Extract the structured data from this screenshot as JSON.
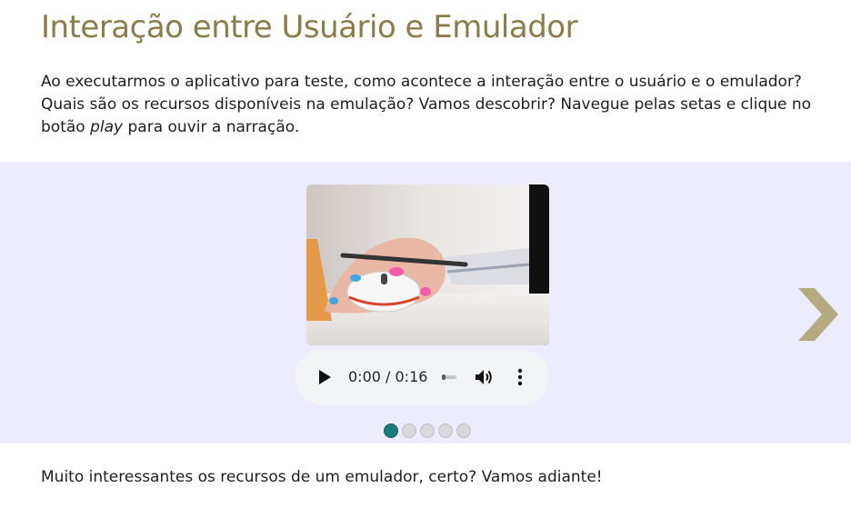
{
  "header": {
    "title": "Interação entre Usuário e Emulador"
  },
  "intro": {
    "text_before": "Ao executarmos o aplicativo para teste, como acontece a interação entre o usuário e o emulador? Quais são os recursos disponíveis na emulação? Vamos descobrir? Navegue pelas setas e clique no botão ",
    "text_italic": "play",
    "text_after": " para ouvir a narração."
  },
  "carousel": {
    "background_color": "#ececfd",
    "slide_count": 5,
    "active_slide": 1,
    "active_dot_color": "#1b7c7b",
    "arrow_color": "#b3aa7f",
    "next_arrow_icon": "chevron-right-icon",
    "audio": {
      "current_time": "0:00",
      "duration": "0:16",
      "time_display": "0:00 / 0:16",
      "progress": 0,
      "play_icon": "play-icon",
      "volume_icon": "volume-icon",
      "menu_icon": "more-vertical-icon"
    }
  },
  "closing": {
    "text": "Muito interessantes os recursos de um emulador, certo? Vamos adiante!"
  },
  "colors": {
    "title": "#8b7d4b",
    "text": "#1e1e1e"
  }
}
